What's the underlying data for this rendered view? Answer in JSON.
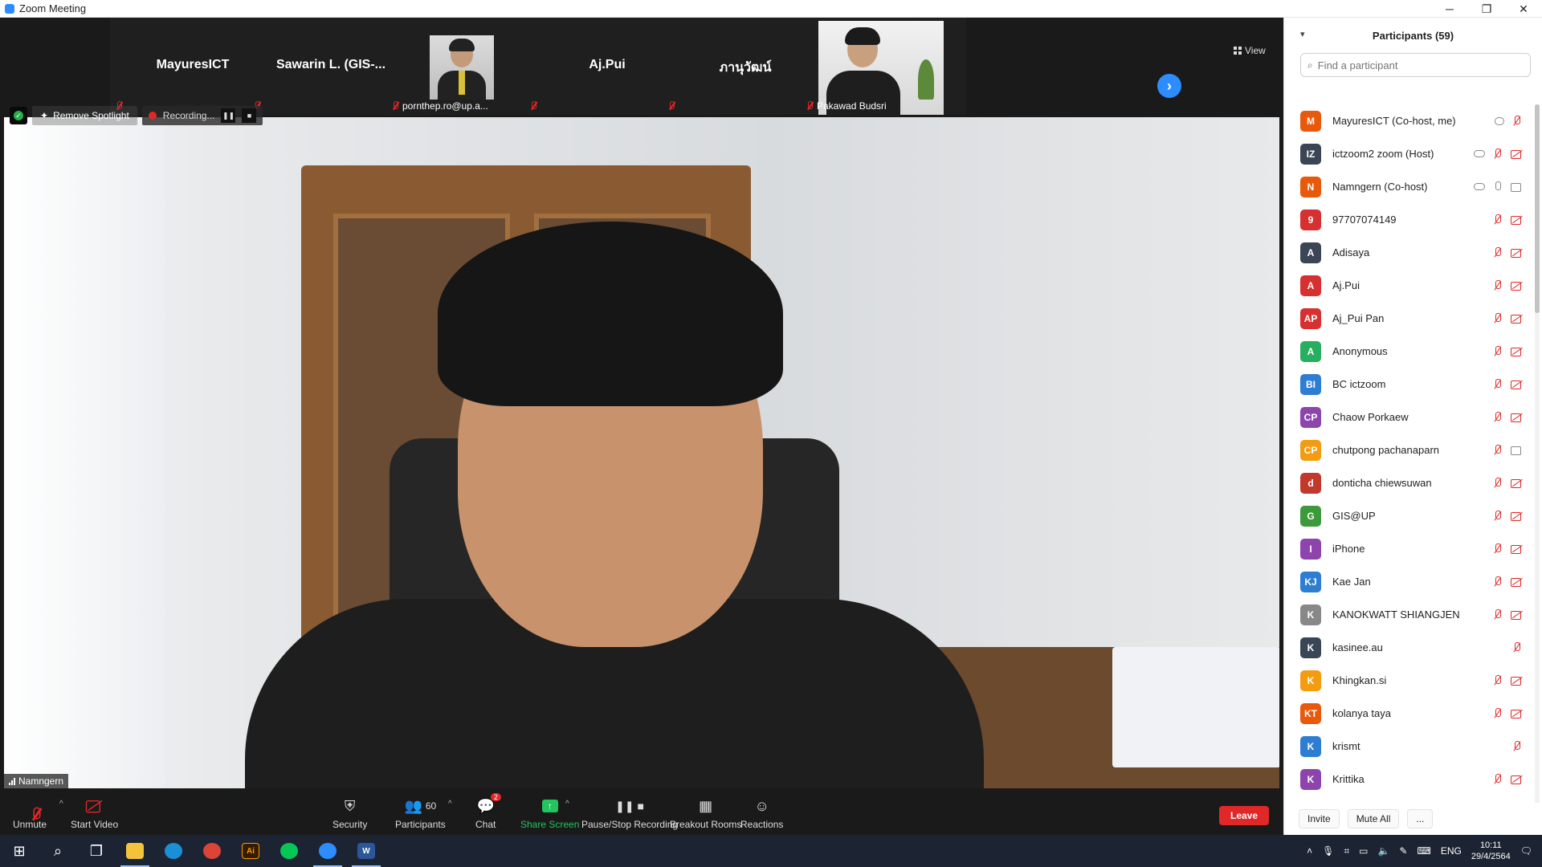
{
  "window": {
    "title": "Zoom Meeting",
    "minimize": "─",
    "restore": "❐",
    "close": "✕"
  },
  "strip": {
    "tiles": [
      {
        "name": "MayuresICT"
      },
      {
        "name": "Sawarin L. (GIS-..."
      },
      {
        "label": "pornthep.ro@up.a..."
      },
      {
        "name": "Aj.Pui"
      },
      {
        "name": "ภานุวัฒน์"
      },
      {
        "label": "Pakawad Budsri"
      }
    ],
    "next": "›",
    "view_label": "View"
  },
  "spotlight": {
    "remove_label": "Remove Spotlight",
    "recording_label": "Recording...",
    "pause": "❚❚",
    "stop": "■",
    "speaker_name": "Namngern"
  },
  "toolbar": {
    "unmute": "Unmute",
    "start_video": "Start Video",
    "security": "Security",
    "participants": "Participants",
    "participants_count": "60",
    "chat": "Chat",
    "chat_badge": "2",
    "share_screen": "Share Screen",
    "recording": "Pause/Stop Recording",
    "breakout": "Breakout Rooms",
    "reactions": "Reactions",
    "leave": "Leave"
  },
  "panel": {
    "title": "Participants (59)",
    "search_placeholder": "Find a participant",
    "participants": [
      {
        "initials": "M",
        "name": "MayuresICT (Co-host, me)",
        "color": "#e8590c"
      },
      {
        "initials": "IZ",
        "name": "ictzoom2 zoom (Host)",
        "color": "#3a4656"
      },
      {
        "initials": "N",
        "name": "Namngern (Co-host)",
        "color": "#e8590c"
      },
      {
        "initials": "9",
        "name": "97707074149",
        "color": "#d63031"
      },
      {
        "initials": "A",
        "name": "Adisaya",
        "color": "#3a4656"
      },
      {
        "initials": "A",
        "name": "Aj.Pui",
        "color": "#d63031"
      },
      {
        "initials": "AP",
        "name": "Aj_Pui Pan",
        "color": "#d63031"
      },
      {
        "initials": "A",
        "name": "Anonymous",
        "color": "#27ae60"
      },
      {
        "initials": "BI",
        "name": "BC ictzoom",
        "color": "#2d7dd2"
      },
      {
        "initials": "CP",
        "name": "Chaow Porkaew",
        "color": "#8e44ad"
      },
      {
        "initials": "CP",
        "name": "chutpong pachanaparn",
        "color": "#f39c12"
      },
      {
        "initials": "d",
        "name": "donticha chiewsuwan",
        "color": "#c0392b"
      },
      {
        "initials": "G",
        "name": "GIS@UP",
        "color": "#3c9a3c"
      },
      {
        "initials": "I",
        "name": "iPhone",
        "color": "#8e44ad"
      },
      {
        "initials": "KJ",
        "name": "Kae Jan",
        "color": "#2d7dd2"
      },
      {
        "initials": "K",
        "name": "KANOKWATT SHIANGJEN",
        "color": "#888888"
      },
      {
        "initials": "K",
        "name": "kasinee.au",
        "color": "#3a4656"
      },
      {
        "initials": "K",
        "name": "Khingkan.si",
        "color": "#f39c12"
      },
      {
        "initials": "KT",
        "name": "kolanya taya",
        "color": "#e8590c"
      },
      {
        "initials": "K",
        "name": "krismt",
        "color": "#2d7dd2"
      },
      {
        "initials": "K",
        "name": "Krittika",
        "color": "#8e44ad"
      }
    ],
    "invite": "Invite",
    "mute_all": "Mute All",
    "more": "..."
  },
  "taskbar": {
    "lang": "ENG",
    "time": "10:11",
    "date": "29/4/2564",
    "ai_label": "Ai",
    "word_label": "W"
  }
}
